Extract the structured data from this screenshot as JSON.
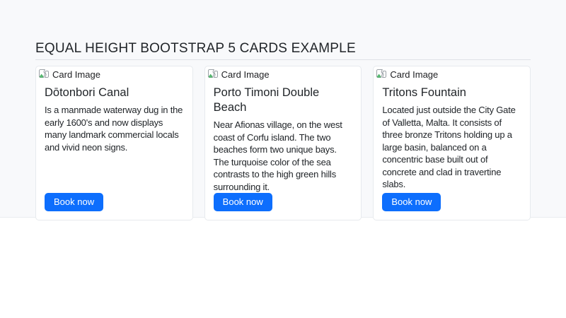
{
  "page": {
    "heading": "EQUAL HEIGHT BOOTSTRAP 5 CARDS EXAMPLE"
  },
  "colors": {
    "section_background": "#f8f9fb",
    "card_background": "#ffffff",
    "card_border": "#e7eaee",
    "primary_button": "#0d6efd",
    "text": "#212529"
  },
  "cards": [
    {
      "image_alt": "Card Image",
      "title": "Dōtonbori Canal",
      "description": "Is a manmade waterway dug in the early 1600's and now displays many landmark commercial locals and vivid neon signs.",
      "button_label": "Book now"
    },
    {
      "image_alt": "Card Image",
      "title": "Porto Timoni Double Beach",
      "description": "Near Afionas village, on the west coast of Corfu island. The two beaches form two unique bays. The turquoise color of the sea contrasts to the high green hills surrounding it.",
      "button_label": "Book now"
    },
    {
      "image_alt": "Card Image",
      "title": "Tritons Fountain",
      "description": "Located just outside the City Gate of Valletta, Malta. It consists of three bronze Tritons holding up a large basin, balanced on a concentric base built out of concrete and clad in travertine slabs.",
      "button_label": "Book now"
    }
  ]
}
